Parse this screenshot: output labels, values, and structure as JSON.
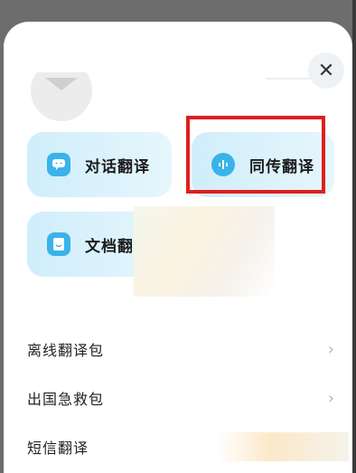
{
  "close_label": "✕",
  "feature_cards": [
    {
      "label": "对话翻译",
      "icon": "chat-bubble-icon"
    },
    {
      "label": "同传翻译",
      "icon": "sound-wave-icon"
    },
    {
      "label": "文档翻",
      "icon": "document-icon"
    }
  ],
  "list_items": [
    {
      "label": "离线翻译包"
    },
    {
      "label": "出国急救包"
    },
    {
      "label": "短信翻译"
    }
  ],
  "colors": {
    "accent": "#39b3ea",
    "card_bg": "#cfeefb",
    "highlight": "#e01e1e"
  }
}
